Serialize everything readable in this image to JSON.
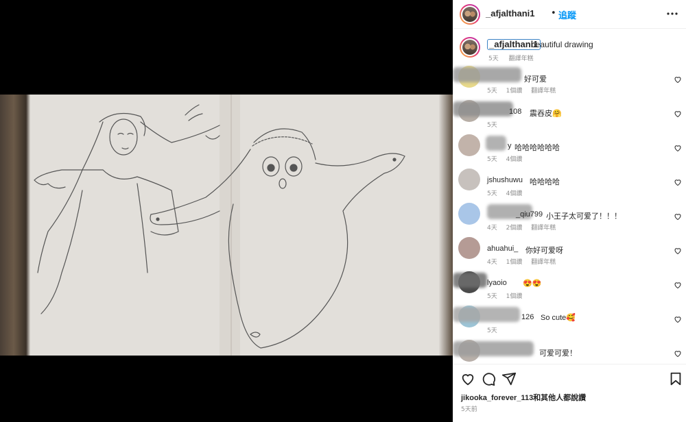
{
  "header": {
    "username": "_afjalthani1",
    "separator": "•",
    "follow_label": "追蹤",
    "more_icon": "more-horizontal-icon"
  },
  "caption": {
    "username": "_afjalthani1",
    "text": "beautiful drawing",
    "time": "5天",
    "translate": "翻譯年糕"
  },
  "comments": [
    {
      "user": "",
      "text": "好可爱",
      "time": "5天",
      "likes": "1個讚",
      "translate": "翻譯年糕",
      "avatar_color": "#e8d98a"
    },
    {
      "user": "108",
      "text": "震吞皮🤗",
      "time": "5天",
      "likes": "",
      "translate": "",
      "avatar_color": "#b7aea6"
    },
    {
      "user": "y",
      "text": "哈哈哈哈哈哈",
      "time": "5天",
      "likes": "4個讚",
      "translate": "",
      "avatar_color": "#c2b3aa"
    },
    {
      "user": "jshushuwu",
      "text": "哈哈哈哈",
      "time": "5天",
      "likes": "4個讚",
      "translate": "",
      "avatar_color": "#c7c1bd"
    },
    {
      "user": "_qiu799",
      "text": "小王子太可爱了！！！",
      "time": "4天",
      "likes": "2個讚",
      "translate": "翻譯年糕",
      "avatar_color": "#a9c6e8"
    },
    {
      "user": "ahuahui_",
      "text": "你好可爱呀",
      "time": "4天",
      "likes": "1個讚",
      "translate": "翻譯年糕",
      "avatar_color": "#b59b95"
    },
    {
      "user": "lyaoio",
      "text": "😍😍",
      "time": "5天",
      "likes": "1個讚",
      "translate": "",
      "avatar_color": "#4a4a4a"
    },
    {
      "user": "126",
      "text": "So cute🥰",
      "time": "5天",
      "likes": "",
      "translate": "",
      "avatar_color": "#9cc4d6"
    },
    {
      "user": "",
      "text": "可爱可爱！",
      "time": "",
      "likes": "",
      "translate": "",
      "avatar_color": "#b9b0aa"
    }
  ],
  "actions": {
    "like_icon": "heart-icon",
    "comment_icon": "comment-icon",
    "share_icon": "send-icon",
    "save_icon": "bookmark-icon",
    "liked_by": "jikooka_forever_113和其他人都說讚",
    "post_time": "5天前"
  }
}
